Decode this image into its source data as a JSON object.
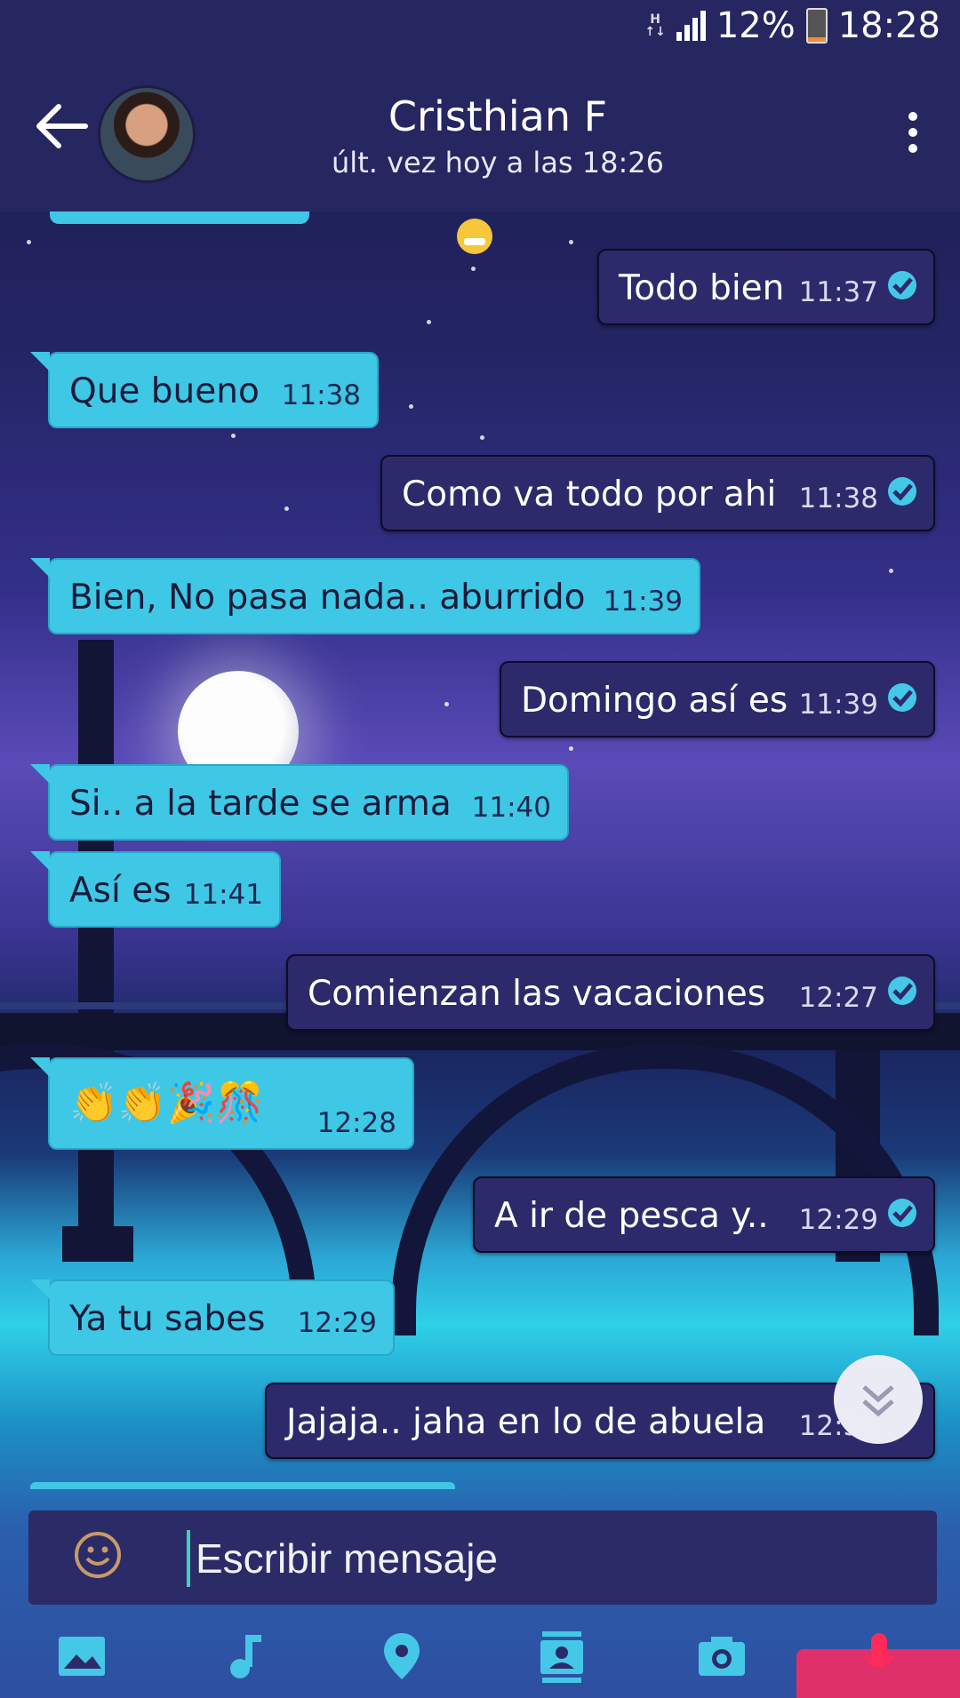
{
  "status_bar": {
    "network": "H",
    "battery": "12%",
    "time": "18:28"
  },
  "header": {
    "contact_name": "Cristhian F",
    "last_seen": "últ. vez hoy a las 18:26"
  },
  "messages": [
    {
      "dir": "out",
      "text": "Todo bien",
      "time": "11:37"
    },
    {
      "dir": "in",
      "text": "Que bueno",
      "time": "11:38"
    },
    {
      "dir": "out",
      "text": "Como va todo por ahi",
      "time": "11:38"
    },
    {
      "dir": "in",
      "text": "Bien, No pasa nada.. aburrido",
      "time": "11:39"
    },
    {
      "dir": "out",
      "text": "Domingo así es",
      "time": "11:39"
    },
    {
      "dir": "in",
      "text": "Si.. a la tarde se arma",
      "time": "11:40"
    },
    {
      "dir": "in",
      "text": "Así es",
      "time": "11:41"
    },
    {
      "dir": "out",
      "text": "Comienzan las vacaciones",
      "time": "12:27"
    },
    {
      "dir": "in",
      "text": "👏👏🎉🎊",
      "time": "12:28"
    },
    {
      "dir": "out",
      "text": "A ir de pesca y..",
      "time": "12:29"
    },
    {
      "dir": "in",
      "text": "Ya tu sabes",
      "time": "12:29"
    },
    {
      "dir": "out",
      "text": "Jajaja.. jaha en lo de abuela",
      "time": "12:30"
    }
  ],
  "composer": {
    "placeholder": "Escribir mensaje"
  },
  "icons": [
    "back-arrow-icon",
    "more-vert-icon",
    "read-check-icon",
    "smiley-icon",
    "image-icon",
    "music-note-icon",
    "location-pin-icon",
    "contact-card-icon",
    "camera-icon",
    "mic-icon",
    "scroll-down-icon"
  ],
  "colors": {
    "header_bg": "#262660",
    "incoming": "#3fc7e6",
    "outgoing": "#2c2a6a",
    "accent": "#45c8e8"
  }
}
